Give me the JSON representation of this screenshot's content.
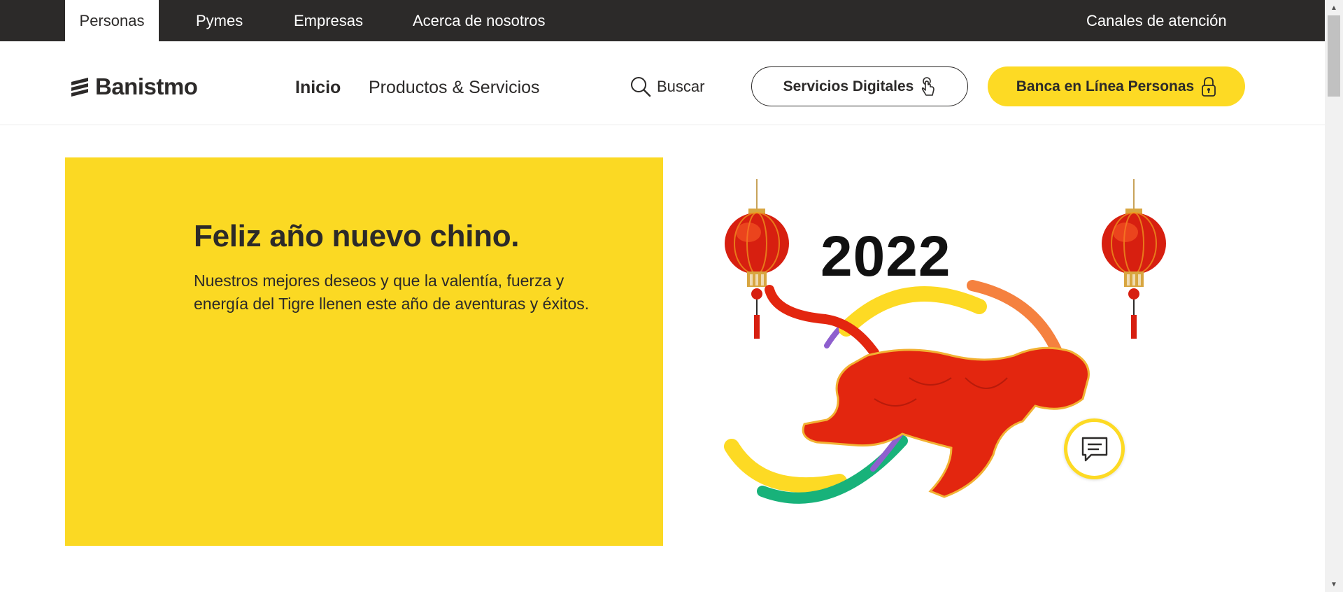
{
  "topbar": {
    "tabs": [
      {
        "label": "Personas"
      },
      {
        "label": "Pymes"
      },
      {
        "label": "Empresas"
      },
      {
        "label": "Acerca de nosotros"
      }
    ],
    "right_link": "Canales de atención"
  },
  "header": {
    "logo_text": "Banistmo",
    "nav": [
      {
        "label": "Inicio"
      },
      {
        "label": "Productos & Servicios"
      }
    ],
    "search_label": "Buscar",
    "digital_services_label": "Servicios Digitales",
    "online_banking_label": "Banca en Línea Personas"
  },
  "hero": {
    "title": "Feliz año nuevo chino.",
    "text": "Nuestros mejores deseos y que la valentía, fuerza y energía del Tigre llenen este año de aventuras y éxitos.",
    "year": "2022"
  },
  "colors": {
    "brand_yellow": "#fdda24",
    "dark": "#2c2a29",
    "tiger_red": "#e3260f",
    "lantern_red": "#d71f10",
    "accent_green": "#18b27a",
    "accent_purple": "#8e5fce",
    "accent_orange": "#f5813f"
  },
  "icons": {
    "search": "search-icon",
    "digital_services": "touch-hand-icon",
    "online_banking": "lock-icon",
    "chat": "chat-icon"
  }
}
